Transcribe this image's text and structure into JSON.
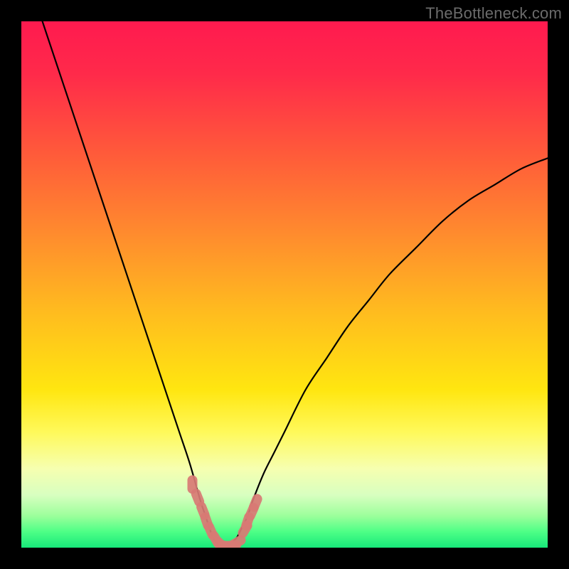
{
  "watermark": "TheBottleneck.com",
  "colors": {
    "frame": "#000000",
    "gradient_stops": [
      {
        "offset": 0.0,
        "color": "#ff1a4f"
      },
      {
        "offset": 0.1,
        "color": "#ff2a4a"
      },
      {
        "offset": 0.25,
        "color": "#ff5a3a"
      },
      {
        "offset": 0.4,
        "color": "#ff8a2e"
      },
      {
        "offset": 0.55,
        "color": "#ffbb1f"
      },
      {
        "offset": 0.7,
        "color": "#ffe610"
      },
      {
        "offset": 0.78,
        "color": "#fff95a"
      },
      {
        "offset": 0.85,
        "color": "#f6ffb0"
      },
      {
        "offset": 0.9,
        "color": "#d8ffc0"
      },
      {
        "offset": 0.94,
        "color": "#9bff9b"
      },
      {
        "offset": 0.97,
        "color": "#4dff86"
      },
      {
        "offset": 1.0,
        "color": "#17e87a"
      }
    ],
    "curve": "#000000",
    "marker_fill": "#d87a74",
    "marker_stroke": "#d87a74"
  },
  "chart_data": {
    "type": "line",
    "title": "",
    "xlabel": "",
    "ylabel": "",
    "xlim": [
      0,
      100
    ],
    "ylim": [
      0,
      100
    ],
    "note": "V-shaped bottleneck curve; y is bottleneck % (0 = no bottleneck, green band). Minimum around x≈38. Values estimated from pixel positions.",
    "series": [
      {
        "name": "bottleneck-curve",
        "x": [
          4,
          6,
          8,
          10,
          12,
          14,
          16,
          18,
          20,
          22,
          24,
          26,
          28,
          30,
          32,
          34,
          35,
          36,
          37,
          38,
          39,
          40,
          41,
          42,
          43,
          44,
          46,
          48,
          50,
          54,
          58,
          62,
          66,
          70,
          75,
          80,
          85,
          90,
          95,
          100
        ],
        "y": [
          100,
          94,
          88,
          82,
          76,
          70,
          64,
          58,
          52,
          46,
          40,
          34,
          28,
          22,
          16,
          9,
          6,
          3,
          1,
          0,
          0,
          1,
          2,
          4,
          6,
          9,
          14,
          18,
          22,
          30,
          36,
          42,
          47,
          52,
          57,
          62,
          66,
          69,
          72,
          74
        ]
      }
    ],
    "markers": {
      "name": "highlighted-points",
      "x": [
        32.5,
        33.5,
        34.5,
        35.2,
        36.0,
        37.0,
        38.0,
        39.0,
        40.0,
        41.0,
        42.5,
        43.0,
        43.8,
        44.5
      ],
      "y": [
        12.0,
        9.5,
        7.0,
        5.0,
        3.2,
        1.5,
        0.5,
        0.3,
        0.4,
        1.0,
        3.5,
        5.0,
        6.8,
        8.5
      ]
    },
    "green_band_y_range": [
      0,
      5
    ]
  }
}
